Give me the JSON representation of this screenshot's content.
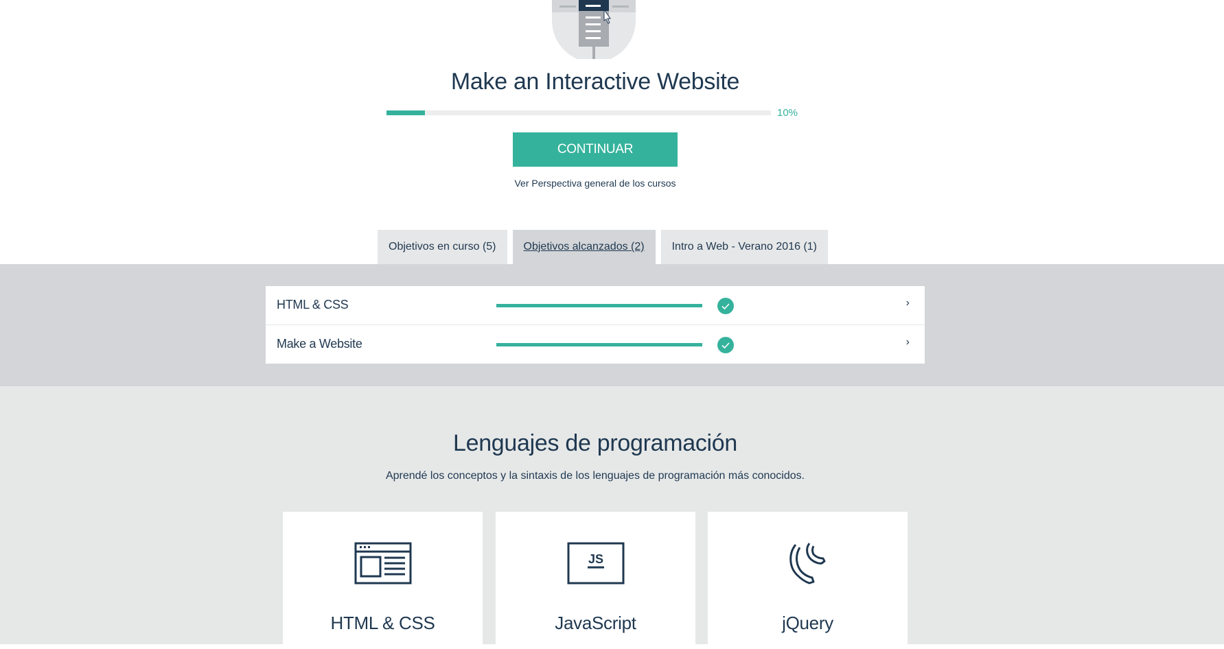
{
  "colors": {
    "accent": "#35b29c",
    "text": "#1f3850",
    "band": "#d3d5d8",
    "section_bg": "#e6e8e8"
  },
  "course": {
    "title": "Make an Interactive Website",
    "progress": 0.1,
    "progress_label": "10%",
    "continue_label": "CONTINUAR",
    "overview_link": "Ver Perspectiva general de los cursos"
  },
  "tabs": [
    {
      "label": "Objetivos en curso (5)",
      "active": false
    },
    {
      "label": "Objetivos alcanzados (2)",
      "active": true
    },
    {
      "label": "Intro a Web - Verano 2016 (1)",
      "active": false
    }
  ],
  "achieved_goals": [
    {
      "name": "HTML & CSS",
      "progress": 1.0,
      "completed": true,
      "icon": "check-circle-icon"
    },
    {
      "name": "Make a Website",
      "progress": 1.0,
      "completed": true,
      "icon": "check-circle-icon"
    }
  ],
  "languages": {
    "title": "Lenguajes de programación",
    "subtitle": "Aprendé los conceptos y la sintaxis de los lenguajes de programación más conocidos.",
    "cards": [
      {
        "name": "HTML & CSS",
        "icon": "browser-window-icon"
      },
      {
        "name": "JavaScript",
        "icon": "js-icon",
        "icon_text": "JS"
      },
      {
        "name": "jQuery",
        "icon": "jquery-icon"
      }
    ]
  }
}
